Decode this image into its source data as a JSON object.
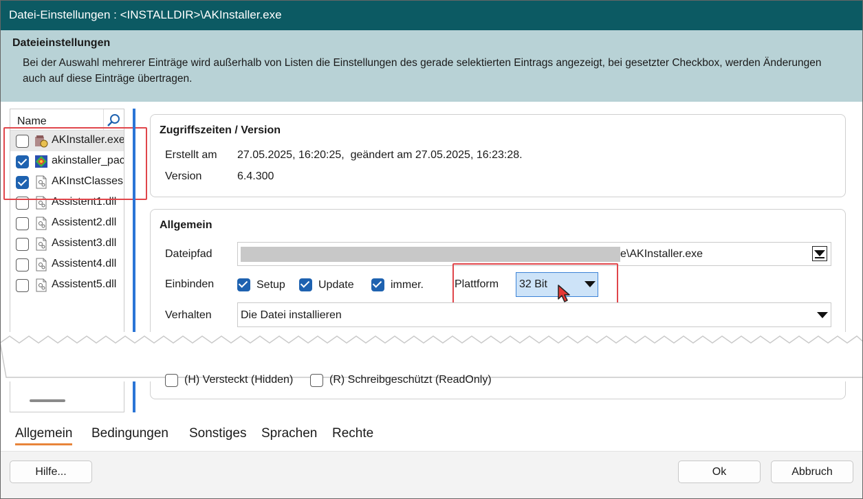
{
  "window": {
    "title": "Datei-Einstellungen : <INSTALLDIR>\\AKInstaller.exe"
  },
  "header": {
    "title": "Dateieinstellungen",
    "description": "Bei der Auswahl mehrerer Einträge wird außerhalb von Listen die Einstellungen des gerade selektierten Eintrags angezeigt, bei gesetzter Checkbox, werden Änderungen auch auf diese Einträge übertragen."
  },
  "filelist": {
    "column": "Name",
    "items": [
      {
        "name": "AKInstaller.exe",
        "checked": false,
        "selected": true,
        "icon": "installer-icon"
      },
      {
        "name": "akinstaller_package",
        "checked": true,
        "selected": false,
        "icon": "package-icon"
      },
      {
        "name": "AKInstClasses.dll",
        "checked": true,
        "selected": false,
        "icon": "dll-file-icon"
      },
      {
        "name": "Assistent1.dll",
        "checked": false,
        "selected": false,
        "icon": "dll-file-icon"
      },
      {
        "name": "Assistent2.dll",
        "checked": false,
        "selected": false,
        "icon": "dll-file-icon"
      },
      {
        "name": "Assistent3.dll",
        "checked": false,
        "selected": false,
        "icon": "dll-file-icon"
      },
      {
        "name": "Assistent4.dll",
        "checked": false,
        "selected": false,
        "icon": "dll-file-icon"
      },
      {
        "name": "Assistent5.dll",
        "checked": false,
        "selected": false,
        "icon": "dll-file-icon"
      }
    ]
  },
  "access": {
    "title": "Zugriffszeiten / Version",
    "created_label": "Erstellt am",
    "created_value": "27.05.2025, 16:20:25,  geändert am 27.05.2025, 16:23:28.",
    "version_label": "Version",
    "version_value": "6.4.300"
  },
  "general": {
    "title": "Allgemein",
    "path_label": "Dateipfad",
    "path_value": "e\\AKInstaller.exe",
    "include_label": "Einbinden",
    "setup": "Setup",
    "update": "Update",
    "always": "immer.",
    "platform_label": "Plattform",
    "platform_value": "32 Bit",
    "behavior_label": "Verhalten",
    "behavior_value": "Die Datei installieren",
    "hidden": "(H) Versteckt (Hidden)",
    "readonly": "(R) Schreibgeschützt (ReadOnly)"
  },
  "tabs": [
    "Allgemein",
    "Bedingungen",
    "Sonstiges",
    "Sprachen",
    "Rechte"
  ],
  "buttons": {
    "help": "Hilfe...",
    "ok": "Ok",
    "cancel": "Abbruch"
  },
  "colors": {
    "title_bar": "#0c5a63",
    "header": "#b8d2d6",
    "accent": "#1e62b0",
    "highlight": "#e0454a",
    "tab_underline": "#e8843a"
  }
}
